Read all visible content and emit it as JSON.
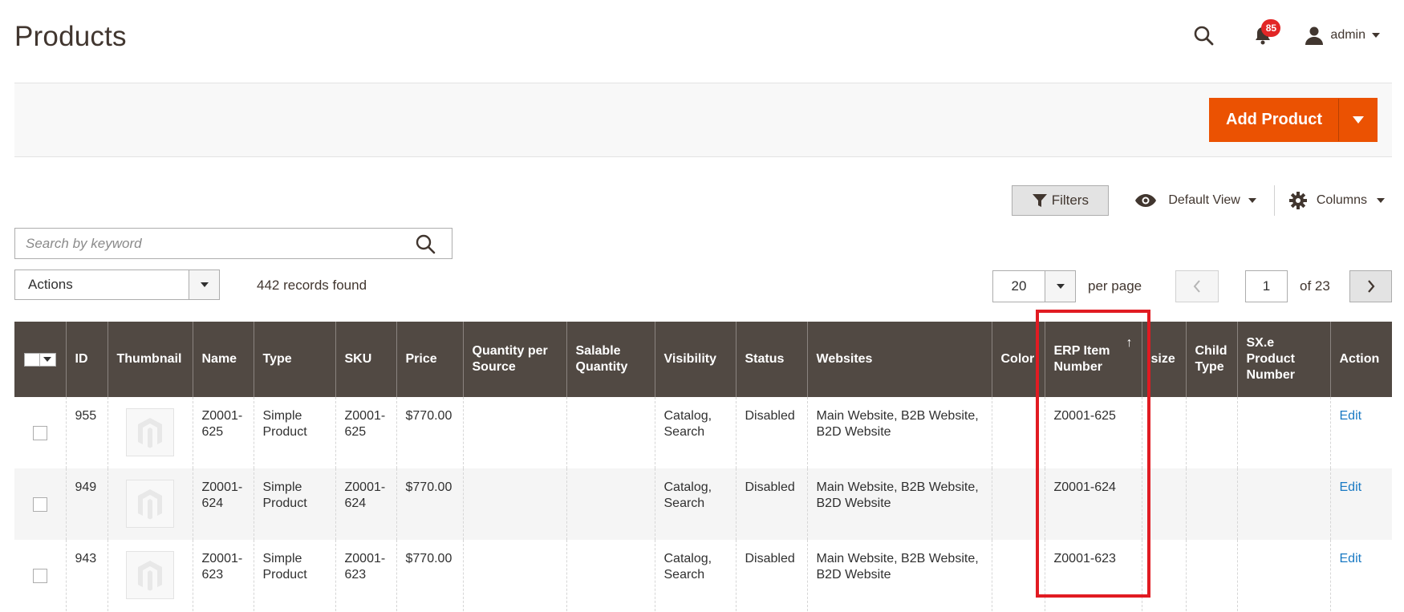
{
  "page": {
    "title": "Products"
  },
  "header": {
    "notification_count": "85",
    "username": "admin"
  },
  "actions_bar": {
    "add_product_label": "Add Product"
  },
  "toolbar": {
    "filters_label": "Filters",
    "view_label": "Default View",
    "columns_label": "Columns",
    "search_placeholder": "Search by keyword",
    "mass_actions_label": "Actions",
    "records_found": "442 records found",
    "per_page_value": "20",
    "per_page_label": "per page",
    "current_page": "1",
    "page_of": "of 23"
  },
  "grid": {
    "columns": [
      "ID",
      "Thumbnail",
      "Name",
      "Type",
      "SKU",
      "Price",
      "Quantity per Source",
      "Salable Quantity",
      "Visibility",
      "Status",
      "Websites",
      "Color",
      "ERP Item Number",
      "size",
      "Child Type",
      "SX.e Product Number",
      "Action"
    ],
    "sort_indicator": "↑",
    "rows": [
      {
        "id": "955",
        "name": "Z0001-625",
        "type": "Simple Product",
        "sku": "Z0001-625",
        "price": "$770.00",
        "qty_per_source": "",
        "salable_qty": "",
        "visibility": "Catalog, Search",
        "status": "Disabled",
        "websites": "Main Website, B2B Website, B2D Website",
        "color": "",
        "erp_item_number": "Z0001-625",
        "size": "",
        "child_type": "",
        "sxe_product_number": "",
        "action": "Edit"
      },
      {
        "id": "949",
        "name": "Z0001-624",
        "type": "Simple Product",
        "sku": "Z0001-624",
        "price": "$770.00",
        "qty_per_source": "",
        "salable_qty": "",
        "visibility": "Catalog, Search",
        "status": "Disabled",
        "websites": "Main Website, B2B Website, B2D Website",
        "color": "",
        "erp_item_number": "Z0001-624",
        "size": "",
        "child_type": "",
        "sxe_product_number": "",
        "action": "Edit"
      },
      {
        "id": "943",
        "name": "Z0001-623",
        "type": "Simple Product",
        "sku": "Z0001-623",
        "price": "$770.00",
        "qty_per_source": "",
        "salable_qty": "",
        "visibility": "Catalog, Search",
        "status": "Disabled",
        "websites": "Main Website, B2B Website, B2D Website",
        "color": "",
        "erp_item_number": "Z0001-623",
        "size": "",
        "child_type": "",
        "sxe_product_number": "",
        "action": "Edit"
      }
    ]
  },
  "colors": {
    "accent": "#eb5202",
    "header_bg": "#514943",
    "highlight": "#e11b22",
    "link": "#1979c3",
    "badge": "#e22626"
  }
}
